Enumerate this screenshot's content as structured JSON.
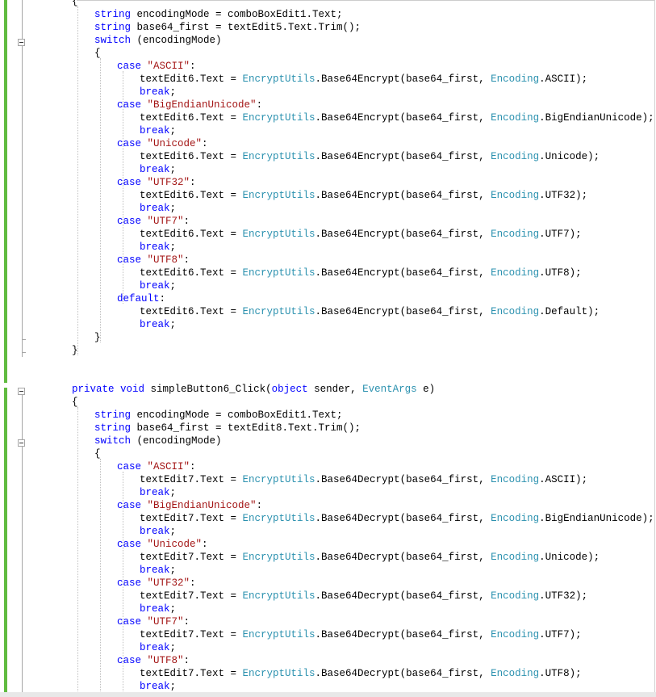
{
  "editor": {
    "colors": {
      "keyword": "#0000ff",
      "type": "#2b91af",
      "string": "#a31515",
      "text": "#000000",
      "change_bar": "#60bb40"
    },
    "lines": [
      [
        {
          "t": "{",
          "c": "text"
        }
      ],
      [
        {
          "t": "string",
          "c": "kw"
        },
        {
          "t": " encodingMode = comboBoxEdit1.Text;",
          "c": "text"
        }
      ],
      [
        {
          "t": "string",
          "c": "kw"
        },
        {
          "t": " base64_first = textEdit5.Text.Trim();",
          "c": "text"
        }
      ],
      [
        {
          "t": "switch",
          "c": "kw"
        },
        {
          "t": " (encodingMode)",
          "c": "text"
        }
      ],
      [
        {
          "t": "{",
          "c": "text"
        }
      ],
      [
        {
          "t": "case",
          "c": "kw"
        },
        {
          "t": " ",
          "c": "text"
        },
        {
          "t": "\"ASCII\"",
          "c": "str"
        },
        {
          "t": ":",
          "c": "text"
        }
      ],
      [
        {
          "t": "textEdit6.Text = ",
          "c": "text"
        },
        {
          "t": "EncryptUtils",
          "c": "ty"
        },
        {
          "t": ".Base64Encrypt(base64_first, ",
          "c": "text"
        },
        {
          "t": "Encoding",
          "c": "ty"
        },
        {
          "t": ".ASCII);",
          "c": "text"
        }
      ],
      [
        {
          "t": "break",
          "c": "kw"
        },
        {
          "t": ";",
          "c": "text"
        }
      ],
      [
        {
          "t": "case",
          "c": "kw"
        },
        {
          "t": " ",
          "c": "text"
        },
        {
          "t": "\"BigEndianUnicode\"",
          "c": "str"
        },
        {
          "t": ":",
          "c": "text"
        }
      ],
      [
        {
          "t": "textEdit6.Text = ",
          "c": "text"
        },
        {
          "t": "EncryptUtils",
          "c": "ty"
        },
        {
          "t": ".Base64Encrypt(base64_first, ",
          "c": "text"
        },
        {
          "t": "Encoding",
          "c": "ty"
        },
        {
          "t": ".BigEndianUnicode);",
          "c": "text"
        }
      ],
      [
        {
          "t": "break",
          "c": "kw"
        },
        {
          "t": ";",
          "c": "text"
        }
      ],
      [
        {
          "t": "case",
          "c": "kw"
        },
        {
          "t": " ",
          "c": "text"
        },
        {
          "t": "\"Unicode\"",
          "c": "str"
        },
        {
          "t": ":",
          "c": "text"
        }
      ],
      [
        {
          "t": "textEdit6.Text = ",
          "c": "text"
        },
        {
          "t": "EncryptUtils",
          "c": "ty"
        },
        {
          "t": ".Base64Encrypt(base64_first, ",
          "c": "text"
        },
        {
          "t": "Encoding",
          "c": "ty"
        },
        {
          "t": ".Unicode);",
          "c": "text"
        }
      ],
      [
        {
          "t": "break",
          "c": "kw"
        },
        {
          "t": ";",
          "c": "text"
        }
      ],
      [
        {
          "t": "case",
          "c": "kw"
        },
        {
          "t": " ",
          "c": "text"
        },
        {
          "t": "\"UTF32\"",
          "c": "str"
        },
        {
          "t": ":",
          "c": "text"
        }
      ],
      [
        {
          "t": "textEdit6.Text = ",
          "c": "text"
        },
        {
          "t": "EncryptUtils",
          "c": "ty"
        },
        {
          "t": ".Base64Encrypt(base64_first, ",
          "c": "text"
        },
        {
          "t": "Encoding",
          "c": "ty"
        },
        {
          "t": ".UTF32);",
          "c": "text"
        }
      ],
      [
        {
          "t": "break",
          "c": "kw"
        },
        {
          "t": ";",
          "c": "text"
        }
      ],
      [
        {
          "t": "case",
          "c": "kw"
        },
        {
          "t": " ",
          "c": "text"
        },
        {
          "t": "\"UTF7\"",
          "c": "str"
        },
        {
          "t": ":",
          "c": "text"
        }
      ],
      [
        {
          "t": "textEdit6.Text = ",
          "c": "text"
        },
        {
          "t": "EncryptUtils",
          "c": "ty"
        },
        {
          "t": ".Base64Encrypt(base64_first, ",
          "c": "text"
        },
        {
          "t": "Encoding",
          "c": "ty"
        },
        {
          "t": ".UTF7);",
          "c": "text"
        }
      ],
      [
        {
          "t": "break",
          "c": "kw"
        },
        {
          "t": ";",
          "c": "text"
        }
      ],
      [
        {
          "t": "case",
          "c": "kw"
        },
        {
          "t": " ",
          "c": "text"
        },
        {
          "t": "\"UTF8\"",
          "c": "str"
        },
        {
          "t": ":",
          "c": "text"
        }
      ],
      [
        {
          "t": "textEdit6.Text = ",
          "c": "text"
        },
        {
          "t": "EncryptUtils",
          "c": "ty"
        },
        {
          "t": ".Base64Encrypt(base64_first, ",
          "c": "text"
        },
        {
          "t": "Encoding",
          "c": "ty"
        },
        {
          "t": ".UTF8);",
          "c": "text"
        }
      ],
      [
        {
          "t": "break",
          "c": "kw"
        },
        {
          "t": ";",
          "c": "text"
        }
      ],
      [
        {
          "t": "default",
          "c": "kw"
        },
        {
          "t": ":",
          "c": "text"
        }
      ],
      [
        {
          "t": "textEdit6.Text = ",
          "c": "text"
        },
        {
          "t": "EncryptUtils",
          "c": "ty"
        },
        {
          "t": ".Base64Encrypt(base64_first, ",
          "c": "text"
        },
        {
          "t": "Encoding",
          "c": "ty"
        },
        {
          "t": ".Default);",
          "c": "text"
        }
      ],
      [
        {
          "t": "break",
          "c": "kw"
        },
        {
          "t": ";",
          "c": "text"
        }
      ],
      [
        {
          "t": "}",
          "c": "text"
        }
      ],
      [
        {
          "t": "}",
          "c": "text"
        }
      ],
      [],
      [],
      [
        {
          "t": "private",
          "c": "kw"
        },
        {
          "t": " ",
          "c": "text"
        },
        {
          "t": "void",
          "c": "kw"
        },
        {
          "t": " simpleButton6_Click(",
          "c": "text"
        },
        {
          "t": "object",
          "c": "kw"
        },
        {
          "t": " sender, ",
          "c": "text"
        },
        {
          "t": "EventArgs",
          "c": "ty"
        },
        {
          "t": " e)",
          "c": "text"
        }
      ],
      [
        {
          "t": "{",
          "c": "text"
        }
      ],
      [
        {
          "t": "string",
          "c": "kw"
        },
        {
          "t": " encodingMode = comboBoxEdit1.Text;",
          "c": "text"
        }
      ],
      [
        {
          "t": "string",
          "c": "kw"
        },
        {
          "t": " base64_first = textEdit8.Text.Trim();",
          "c": "text"
        }
      ],
      [
        {
          "t": "switch",
          "c": "kw"
        },
        {
          "t": " (encodingMode)",
          "c": "text"
        }
      ],
      [
        {
          "t": "{",
          "c": "text"
        }
      ],
      [
        {
          "t": "case",
          "c": "kw"
        },
        {
          "t": " ",
          "c": "text"
        },
        {
          "t": "\"ASCII\"",
          "c": "str"
        },
        {
          "t": ":",
          "c": "text"
        }
      ],
      [
        {
          "t": "textEdit7.Text = ",
          "c": "text"
        },
        {
          "t": "EncryptUtils",
          "c": "ty"
        },
        {
          "t": ".Base64Decrypt(base64_first, ",
          "c": "text"
        },
        {
          "t": "Encoding",
          "c": "ty"
        },
        {
          "t": ".ASCII);",
          "c": "text"
        }
      ],
      [
        {
          "t": "break",
          "c": "kw"
        },
        {
          "t": ";",
          "c": "text"
        }
      ],
      [
        {
          "t": "case",
          "c": "kw"
        },
        {
          "t": " ",
          "c": "text"
        },
        {
          "t": "\"BigEndianUnicode\"",
          "c": "str"
        },
        {
          "t": ":",
          "c": "text"
        }
      ],
      [
        {
          "t": "textEdit7.Text = ",
          "c": "text"
        },
        {
          "t": "EncryptUtils",
          "c": "ty"
        },
        {
          "t": ".Base64Decrypt(base64_first, ",
          "c": "text"
        },
        {
          "t": "Encoding",
          "c": "ty"
        },
        {
          "t": ".BigEndianUnicode);",
          "c": "text"
        }
      ],
      [
        {
          "t": "break",
          "c": "kw"
        },
        {
          "t": ";",
          "c": "text"
        }
      ],
      [
        {
          "t": "case",
          "c": "kw"
        },
        {
          "t": " ",
          "c": "text"
        },
        {
          "t": "\"Unicode\"",
          "c": "str"
        },
        {
          "t": ":",
          "c": "text"
        }
      ],
      [
        {
          "t": "textEdit7.Text = ",
          "c": "text"
        },
        {
          "t": "EncryptUtils",
          "c": "ty"
        },
        {
          "t": ".Base64Decrypt(base64_first, ",
          "c": "text"
        },
        {
          "t": "Encoding",
          "c": "ty"
        },
        {
          "t": ".Unicode);",
          "c": "text"
        }
      ],
      [
        {
          "t": "break",
          "c": "kw"
        },
        {
          "t": ";",
          "c": "text"
        }
      ],
      [
        {
          "t": "case",
          "c": "kw"
        },
        {
          "t": " ",
          "c": "text"
        },
        {
          "t": "\"UTF32\"",
          "c": "str"
        },
        {
          "t": ":",
          "c": "text"
        }
      ],
      [
        {
          "t": "textEdit7.Text = ",
          "c": "text"
        },
        {
          "t": "EncryptUtils",
          "c": "ty"
        },
        {
          "t": ".Base64Decrypt(base64_first, ",
          "c": "text"
        },
        {
          "t": "Encoding",
          "c": "ty"
        },
        {
          "t": ".UTF32);",
          "c": "text"
        }
      ],
      [
        {
          "t": "break",
          "c": "kw"
        },
        {
          "t": ";",
          "c": "text"
        }
      ],
      [
        {
          "t": "case",
          "c": "kw"
        },
        {
          "t": " ",
          "c": "text"
        },
        {
          "t": "\"UTF7\"",
          "c": "str"
        },
        {
          "t": ":",
          "c": "text"
        }
      ],
      [
        {
          "t": "textEdit7.Text = ",
          "c": "text"
        },
        {
          "t": "EncryptUtils",
          "c": "ty"
        },
        {
          "t": ".Base64Decrypt(base64_first, ",
          "c": "text"
        },
        {
          "t": "Encoding",
          "c": "ty"
        },
        {
          "t": ".UTF7);",
          "c": "text"
        }
      ],
      [
        {
          "t": "break",
          "c": "kw"
        },
        {
          "t": ";",
          "c": "text"
        }
      ],
      [
        {
          "t": "case",
          "c": "kw"
        },
        {
          "t": " ",
          "c": "text"
        },
        {
          "t": "\"UTF8\"",
          "c": "str"
        },
        {
          "t": ":",
          "c": "text"
        }
      ],
      [
        {
          "t": "textEdit7.Text = ",
          "c": "text"
        },
        {
          "t": "EncryptUtils",
          "c": "ty"
        },
        {
          "t": ".Base64Decrypt(base64_first, ",
          "c": "text"
        },
        {
          "t": "Encoding",
          "c": "ty"
        },
        {
          "t": ".UTF8);",
          "c": "text"
        }
      ],
      [
        {
          "t": "break",
          "c": "kw"
        },
        {
          "t": ";",
          "c": "text"
        }
      ]
    ]
  }
}
